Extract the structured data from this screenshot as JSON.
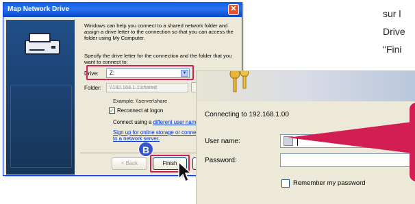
{
  "map_dialog": {
    "title": "Map Network Drive",
    "close_glyph": "✕",
    "intro": "Windows can help you connect to a shared network folder and assign a drive letter to the connection so that you can access the folder using My Computer.",
    "specify": "Specify the drive letter for the connection and the folder that you want to connect to:",
    "drive_label": "Drive:",
    "drive_value": "Z:",
    "folder_label": "Folder:",
    "folder_value": "\\\\192.168.1.1\\shared",
    "example": "Example: \\\\server\\share",
    "reconnect_label": "Reconnect at logon",
    "reconnect_checked": true,
    "connect_as_prefix": "Connect using a ",
    "connect_as_link": "different user nam",
    "signup_link": "Sign up for online storage or connect to a network server.",
    "back_label": "< Back",
    "finish_label": "Finish",
    "step_badge": "B"
  },
  "side_text": {
    "line1": "sur l",
    "line2": "Drive",
    "line3": "\"Fini"
  },
  "login_dialog": {
    "connecting_text": "Connecting to 192.168.1.00",
    "username_label": "User name:",
    "username_value": "",
    "password_label": "Password:",
    "password_value": "",
    "remember_label": "Remember my password",
    "remember_checked": false
  },
  "colors": {
    "highlight": "#d21e52",
    "xp_titlebar": "#0a5fe8",
    "badge": "#3456c8",
    "link": "#0033cc"
  },
  "icons": [
    "drive-icon",
    "close-icon",
    "dropdown-arrow-icon",
    "checkbox-icon",
    "pointer-cursor-icon",
    "keys-icon",
    "user-avatar-icon"
  ]
}
